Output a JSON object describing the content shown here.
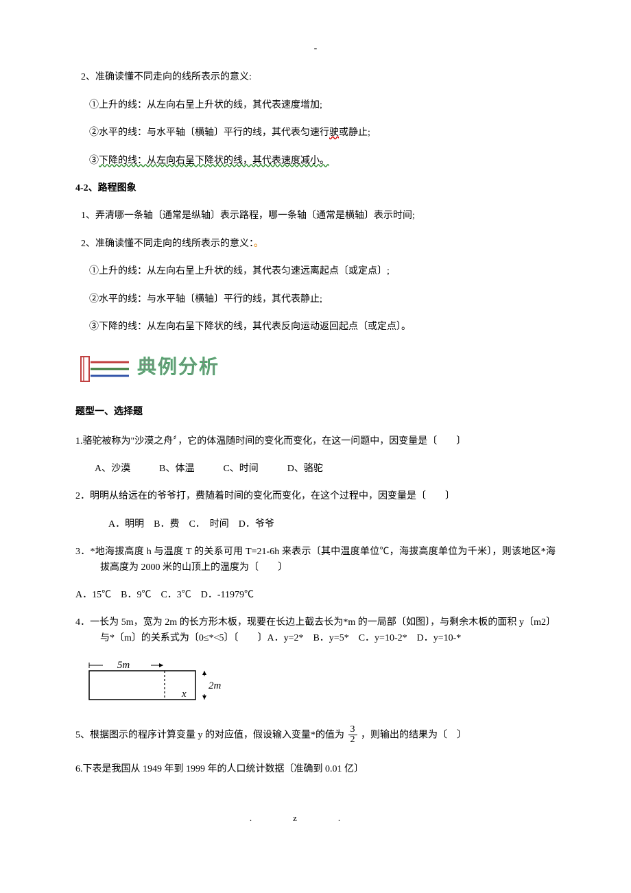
{
  "header": {
    "dash": "-"
  },
  "intro": {
    "line1": "2、准确读懂不同走向的线所表示的意义:",
    "sub1": "①上升的线：从左向右呈上升状的线，其代表速度增加;",
    "sub2_a": "②水平的线：与水平轴〔横轴〕平行的线，其代表匀速行",
    "sub2_b": "驶",
    "sub2_c": "或静止;",
    "sub3_a": "③",
    "sub3_b": "下降的线：从左向右呈下降状的线，其代表速度减小。"
  },
  "sec42": {
    "title": "4-2、路程图象",
    "line1": "1、弄清哪一条轴〔通常是纵轴〕表示路程，哪一条轴〔通常是横轴〕表示时间;",
    "line2a": "2、准确读懂不同走向的线所表示的意义：",
    "line2dot": "。",
    "sub1": "①上升的线：从左向右呈上升状的线，其代表匀速远离起点〔或定点〕;",
    "sub2": "②水平的线：与水平轴〔横轴〕平行的线，其代表静止;",
    "sub3": "③下降的线：从左向右呈下降状的线，其代表反向运动返回起点〔或定点〕。"
  },
  "dianli": {
    "text": "典例分析"
  },
  "questions": {
    "section_title": "题型一、选择题",
    "q1": {
      "stem": "1.骆驼被称为\"沙漠之舟〞，它的体温随时间的变化而变化，在这一问题中，因变量是〔　　〕",
      "opts": "A、沙漠　　　B、体温　　　C、时间　　　D、骆驼"
    },
    "q2": {
      "stem": "2．明明从给远在的爷爷打，费随着时间的变化而变化，在这个过程中，因变量是〔　　〕",
      "opts": "A．明明　B．费　C．　时间　D．爷爷"
    },
    "q3": {
      "stem": "3．*地海拔高度 h 与温度 T 的关系可用 T=21-6h 来表示〔其中温度单位℃，海拔高度单位为千米〕，则该地区*海拔高度为 2000 米的山顶上的温度为〔　　〕",
      "opts": "A．15℃　B．9℃　C．3℃　D．-11979℃"
    },
    "q4": {
      "stem": "4．一长为 5m，宽为 2m 的长方形木板，现要在长边上截去长为*m 的一局部〔如图〕，与剩余木板的面积 y〔m2〕与*〔m〕的关系式为〔0≤*<5〕〔　　〕A．y=2*　B．y=5*　C．y=10-2*　D．y=10-*",
      "labels": {
        "w": "5m",
        "h": "2m",
        "x": "x"
      }
    },
    "q5": {
      "stem_a": "5、根据图示的程序计算变量 y 的对应值，假设输入变量*的值为",
      "frac_num": "3",
      "frac_den": "2",
      "stem_b": "，则输出的结果为〔　〕"
    },
    "q6": {
      "stem": "6.下表是我国从 1949 年到 1999 年的人口统计数据〔准确到 0.01 亿〕"
    }
  },
  "footer": {
    "dot": ".",
    "z": "z."
  }
}
